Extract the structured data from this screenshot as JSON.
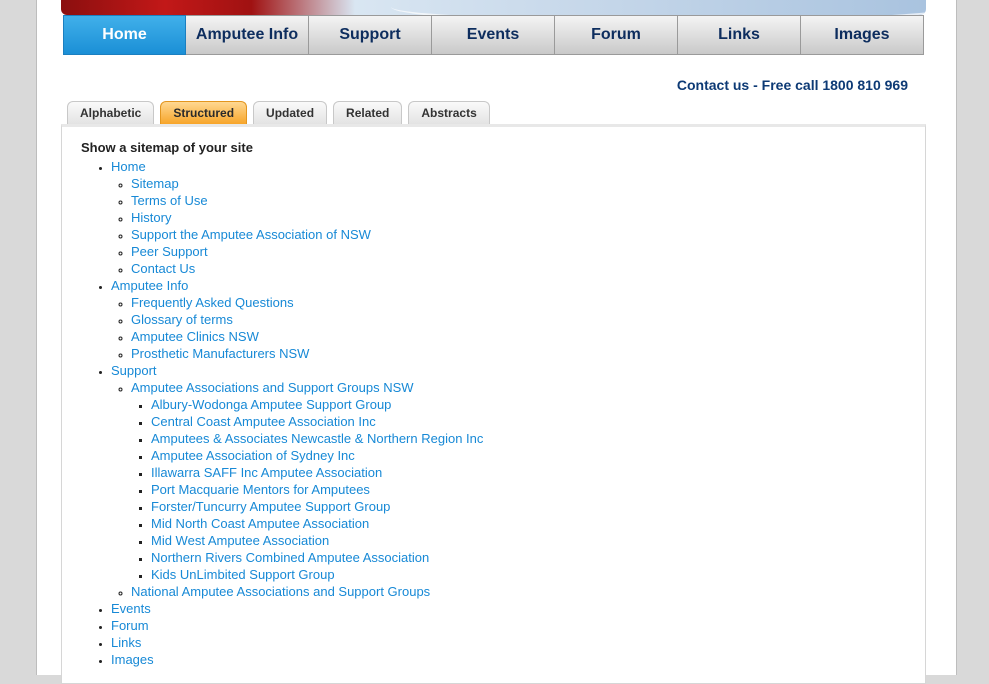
{
  "nav": {
    "items": [
      "Home",
      "Amputee Info",
      "Support",
      "Events",
      "Forum",
      "Links",
      "Images"
    ]
  },
  "contact": "Contact us - Free call 1800 810 969",
  "tabs": [
    "Alphabetic",
    "Structured",
    "Updated",
    "Related",
    "Abstracts"
  ],
  "sitemap": {
    "heading": "Show a sitemap of your site",
    "home": {
      "label": "Home",
      "children": [
        "Sitemap",
        "Terms of Use",
        "History",
        "Support the Amputee Association of NSW",
        "Peer Support",
        "Contact Us"
      ]
    },
    "amputee_info": {
      "label": "Amputee Info",
      "children": [
        "Frequently Asked Questions",
        "Glossary of terms",
        "Amputee Clinics NSW",
        "Prosthetic Manufacturers NSW"
      ]
    },
    "support": {
      "label": "Support",
      "nsw_groups": {
        "label": "Amputee Associations and Support Groups NSW",
        "children": [
          "Albury-Wodonga Amputee Support Group",
          "Central Coast Amputee Association Inc",
          "Amputees & Associates Newcastle & Northern Region Inc",
          "Amputee Association of Sydney Inc",
          "Illawarra SAFF Inc Amputee Association",
          "Port Macquarie Mentors for Amputees",
          "Forster/Tuncurry Amputee Support Group",
          "Mid North Coast Amputee Association",
          "Mid West Amputee Association",
          "Northern Rivers Combined Amputee Association",
          "Kids UnLimbited Support Group"
        ]
      },
      "national_groups": "National Amputee Associations and Support Groups"
    },
    "events": "Events",
    "forum": "Forum",
    "links": "Links",
    "images": "Images"
  }
}
